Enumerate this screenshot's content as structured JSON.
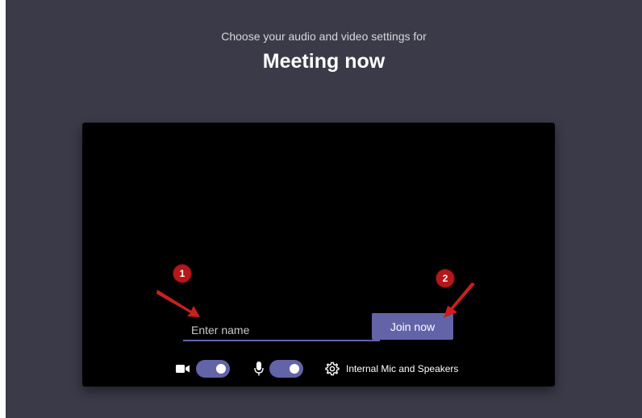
{
  "header": {
    "subtitle": "Choose your audio and video settings for",
    "title": "Meeting now"
  },
  "join": {
    "name_placeholder": "Enter name",
    "name_value": "",
    "button_label": "Join now"
  },
  "controls": {
    "camera_icon": "video-camera-icon",
    "camera_on": true,
    "mic_icon": "microphone-icon",
    "mic_on": true,
    "device_icon": "gear-icon",
    "device_label": "Internal Mic and Speakers"
  },
  "annotations": {
    "marker_1": "1",
    "marker_2": "2",
    "color": "#b3181b"
  },
  "colors": {
    "accent": "#6264a7",
    "background": "#3b3a48",
    "preview": "#000000"
  }
}
